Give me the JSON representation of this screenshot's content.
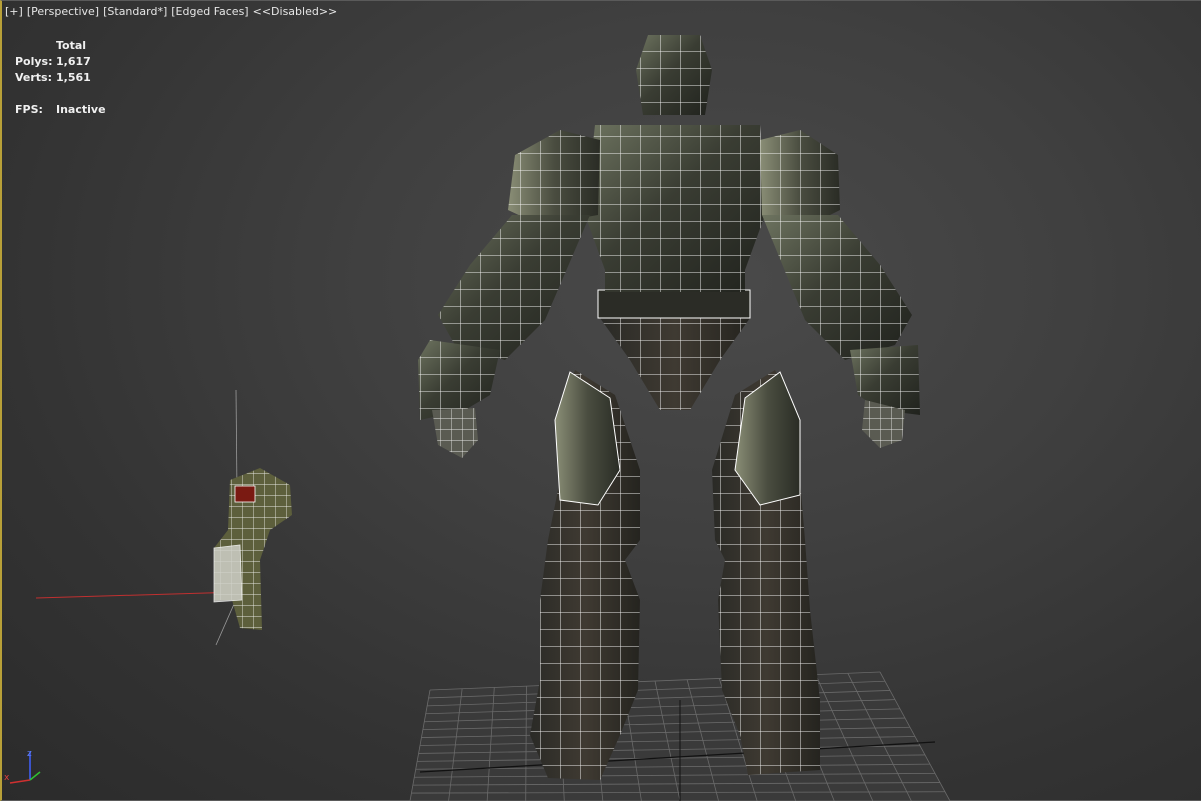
{
  "viewport": {
    "label_plus": "[+]",
    "label_view": "[Perspective]",
    "label_shading": "[Standard*]",
    "label_edged": "[Edged Faces]",
    "label_disabled": "<<Disabled>>"
  },
  "stats": {
    "header": "Total",
    "polys_label": "Polys:",
    "polys_value": "1,617",
    "verts_label": "Verts:",
    "verts_value": "1,561",
    "fps_label": "FPS:",
    "fps_value": "Inactive"
  },
  "axis_gizmo": {
    "z": "z",
    "x": "x",
    "colors": {
      "x": "#d03030",
      "y": "#30c030",
      "z": "#4060ff"
    }
  },
  "scene": {
    "model": "armored-character-mesh",
    "prop": "rifle-mesh",
    "wire_color": "#ffffff"
  }
}
